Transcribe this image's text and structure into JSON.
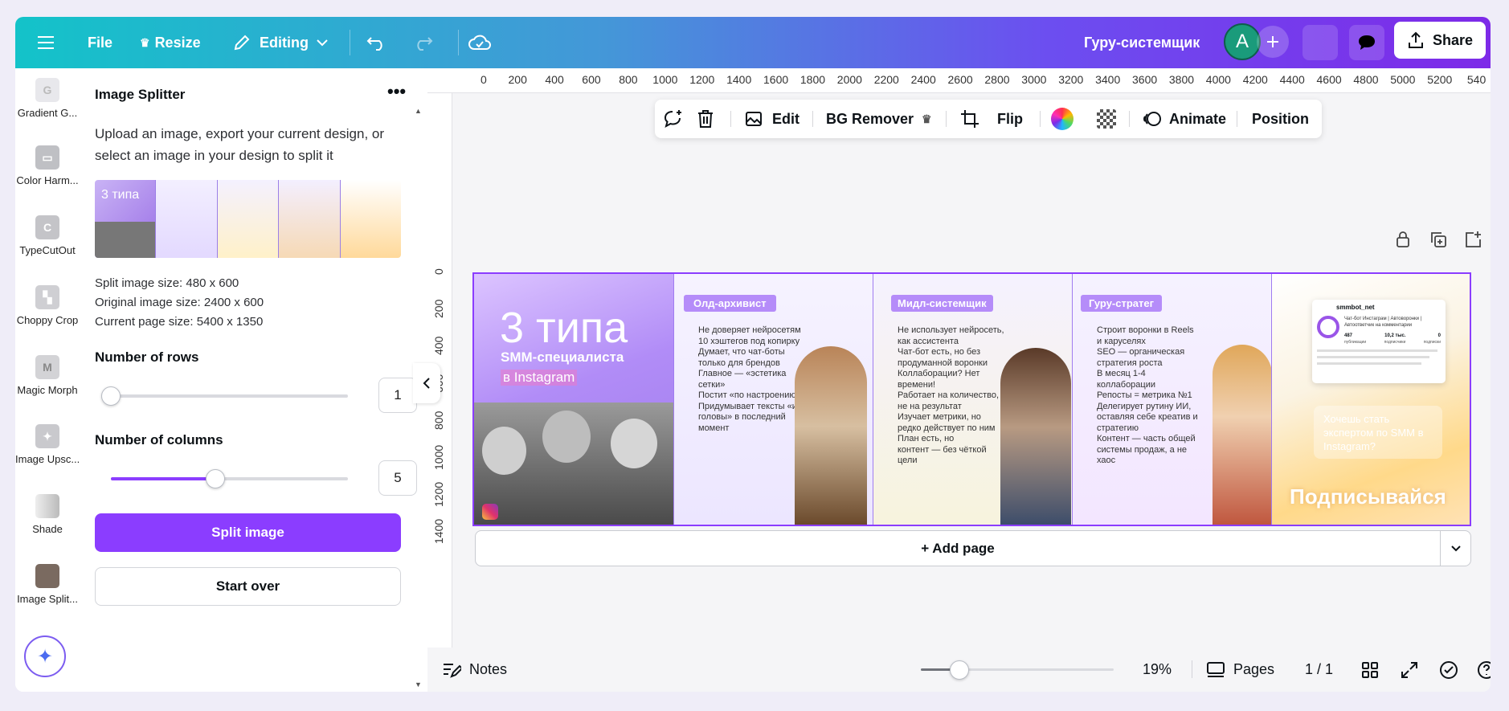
{
  "topbar": {
    "file_label": "File",
    "resize_label": "Resize",
    "editing_label": "Editing",
    "project_title": "Гуру-системщик",
    "avatar_letter": "A",
    "share_label": "Share"
  },
  "rail": {
    "items": [
      {
        "label": "Gradient G..."
      },
      {
        "label": "Color Harm..."
      },
      {
        "label": "TypeCutOut"
      },
      {
        "label": "Choppy Crop"
      },
      {
        "label": "Magic Morph"
      },
      {
        "label": "Image Upsc..."
      },
      {
        "label": "Shade"
      },
      {
        "label": "Image Split..."
      }
    ]
  },
  "panel": {
    "title": "Image Splitter",
    "description": "Upload an image, export your current design, or select an image in your design to split it",
    "split_size": "Split image size: 480 x 600",
    "original_size": "Original image size: 2400 x 600",
    "page_size": "Current page size: 5400 x 1350",
    "rows_label": "Number of rows",
    "rows_value": "1",
    "rows_fraction": 0.0,
    "columns_label": "Number of columns",
    "columns_value": "5",
    "columns_fraction": 0.44,
    "split_button": "Split image",
    "start_over_button": "Start over"
  },
  "ruler": {
    "h_ticks": [
      "0",
      "200",
      "400",
      "600",
      "800",
      "1000",
      "1200",
      "1400",
      "1600",
      "1800",
      "2000",
      "2200",
      "2400",
      "2600",
      "2800",
      "3000",
      "3200",
      "3400",
      "3600",
      "3800",
      "4000",
      "4200",
      "4400",
      "4600",
      "4800",
      "5000",
      "5200",
      "540"
    ],
    "v_ticks": [
      "0",
      "200",
      "400",
      "600",
      "800",
      "1000",
      "1200",
      "1400"
    ]
  },
  "context_toolbar": {
    "edit_label": "Edit",
    "bg_remover_label": "BG Remover",
    "flip_label": "Flip",
    "animate_label": "Animate",
    "position_label": "Position"
  },
  "design": {
    "hero_title": "3 типа",
    "hero_subtitle": "SMM-специалиста",
    "hero_tag": "в Instagram",
    "col1_title": "Олд-архивист",
    "col1_bullets": [
      "Не доверяет нейросетям",
      "10 хэштегов под копирку",
      "Думает, что чат-боты",
      "только для брендов",
      "Главное — «эстетика",
      "сетки»",
      "Постит «по настроению»",
      "Придумывает тексты «из",
      "головы» в последний",
      "момент"
    ],
    "col2_title": "Мидл-системщик",
    "col2_bullets": [
      "Не использует нейросеть,",
      "как ассистента",
      "Чат-бот есть, но без",
      "продуманной воронки",
      "Коллаборации? Нет",
      "времени!",
      "Работает на количество, а",
      "не на результат",
      "Изучает метрики, но",
      "редко действует по ним",
      "План есть, но",
      "контент — без чёткой",
      "цели"
    ],
    "col3_title": "Гуру-стратег",
    "col3_bullets": [
      "Строит воронки в Reels",
      "и каруселях",
      "SEO — органическая",
      "стратегия роста",
      "В месяц 1-4",
      "коллаборации",
      "Репосты = метрика №1",
      "Делегирует рутину ИИ,",
      "оставляя себе креатив и",
      "стратегию",
      "Контент — часть общей",
      "системы продаж, а не",
      "хаос"
    ],
    "profile_name": "smmbot_net",
    "profile_bio": "Чат-бот Инстаграм | Автоворонки | Автоответчик на комментарии",
    "profile_stats": [
      "487",
      "10,2 тыс.",
      "0"
    ],
    "profile_stat_labels": [
      "публикации",
      "подписчики",
      "подписки"
    ],
    "cta_text": "Хочешь стать экспертом по SMM в Instagram?",
    "subscribe_text": "Подписывайся"
  },
  "add_page_label": "+ Add page",
  "bottombar": {
    "notes_label": "Notes",
    "zoom_value": "19%",
    "zoom_fraction": 0.2,
    "pages_label": "Pages",
    "page_counter": "1 / 1"
  },
  "colors": {
    "accent": "#8b3dff",
    "topbar_start": "#13c3c9",
    "topbar_end": "#7d2ae8"
  }
}
